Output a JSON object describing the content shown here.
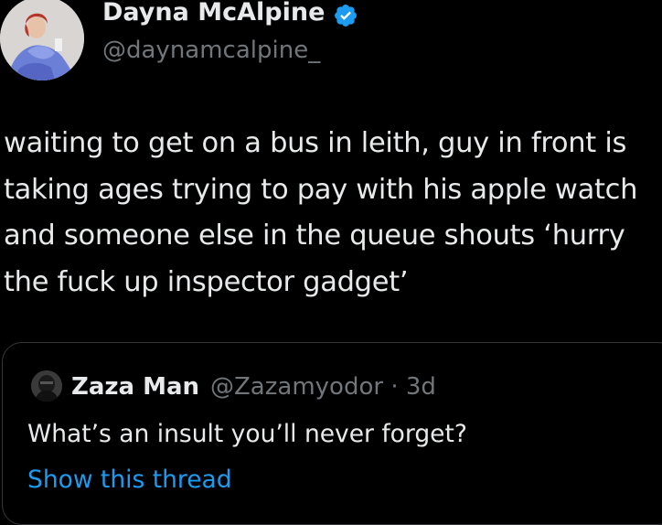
{
  "tweet": {
    "author": {
      "display_name": "Dayna McAlpine",
      "handle": "@daynamcalpine_",
      "verified": true,
      "verified_color": "#1d9bf0"
    },
    "text": "waiting to get on a bus in leith, guy in front is\ntaking ages trying to pay with his apple watch\nand someone else in the queue shouts ‘hurry\nthe fuck up inspector gadget’"
  },
  "quoted_tweet": {
    "author_name": "Zaza Man",
    "author_handle": "@Zazamyodor",
    "separator": "·",
    "time_ago": "3d",
    "text": "What’s an insult you’ll never forget?",
    "show_thread_label": "Show this thread",
    "link_color": "#1d9bf0"
  },
  "colors": {
    "background": "#000000",
    "primary_text": "#e7e9ea",
    "secondary_text": "#71767b",
    "border": "#333639"
  }
}
